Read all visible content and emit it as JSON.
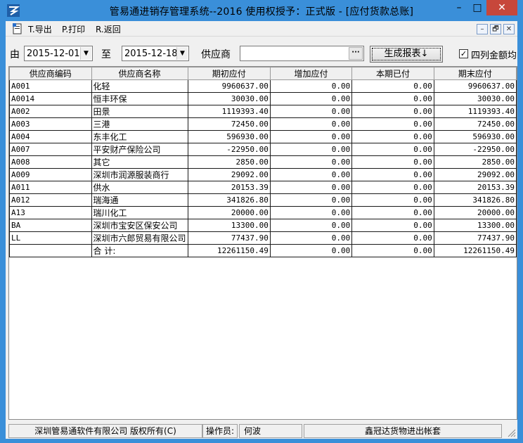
{
  "window": {
    "title": "管易通进销存管理系统--2016  使用权授予：正式版 - [应付货款总账]",
    "min_glyph": "–",
    "max_glyph": "□",
    "close_glyph": "✕"
  },
  "menu": {
    "items": [
      "T.导出",
      "P.打印",
      "R.返回"
    ],
    "mdi": [
      "–",
      "🗗",
      "✕"
    ]
  },
  "filter": {
    "from_label": "由",
    "from_date": "2015-12-01",
    "to_label": "至",
    "to_date": "2015-12-18",
    "supplier_label": "供应商",
    "supplier_value": "",
    "ellipsis": "···",
    "generate_button": "生成报表↓",
    "checkbox_label": "四列金额均",
    "checkbox_checked": "✓"
  },
  "table": {
    "headers": [
      "供应商编码",
      "供应商名称",
      "期初应付",
      "增加应付",
      "本期已付",
      "期末应付"
    ],
    "rows": [
      [
        "A001",
        "化轻",
        "9960637.00",
        "0.00",
        "0.00",
        "9960637.00"
      ],
      [
        "A0014",
        "恒丰环保",
        "30030.00",
        "0.00",
        "0.00",
        "30030.00"
      ],
      [
        "A002",
        "田景",
        "1119393.40",
        "0.00",
        "0.00",
        "1119393.40"
      ],
      [
        "A003",
        "三港",
        "72450.00",
        "0.00",
        "0.00",
        "72450.00"
      ],
      [
        "A004",
        "东丰化工",
        "596930.00",
        "0.00",
        "0.00",
        "596930.00"
      ],
      [
        "A007",
        "平安财产保险公司",
        "-22950.00",
        "0.00",
        "0.00",
        "-22950.00"
      ],
      [
        "A008",
        "其它",
        "2850.00",
        "0.00",
        "0.00",
        "2850.00"
      ],
      [
        "A009",
        "深圳市润源服装商行",
        "29092.00",
        "0.00",
        "0.00",
        "29092.00"
      ],
      [
        "A011",
        "供水",
        "20153.39",
        "0.00",
        "0.00",
        "20153.39"
      ],
      [
        "A012",
        "瑞海通",
        "341826.80",
        "0.00",
        "0.00",
        "341826.80"
      ],
      [
        "A13",
        "瑞川化工",
        "20000.00",
        "0.00",
        "0.00",
        "20000.00"
      ],
      [
        "BA",
        "深圳市宝安区保安公司",
        "13300.00",
        "0.00",
        "0.00",
        "13300.00"
      ],
      [
        "LL",
        "深圳市六郎贸易有限公司",
        "77437.90",
        "0.00",
        "0.00",
        "77437.90"
      ]
    ],
    "total": [
      "",
      "合  计:",
      "12261150.49",
      "0.00",
      "0.00",
      "12261150.49"
    ]
  },
  "status": {
    "copyright": "深圳管易通软件有限公司 版权所有(C)",
    "operator_label": "操作员:",
    "operator": "何波",
    "account_set": "鑫冠达货物进出帐套"
  },
  "colors": {
    "titlebar": "#3a8fd9",
    "close": "#c7473b"
  }
}
